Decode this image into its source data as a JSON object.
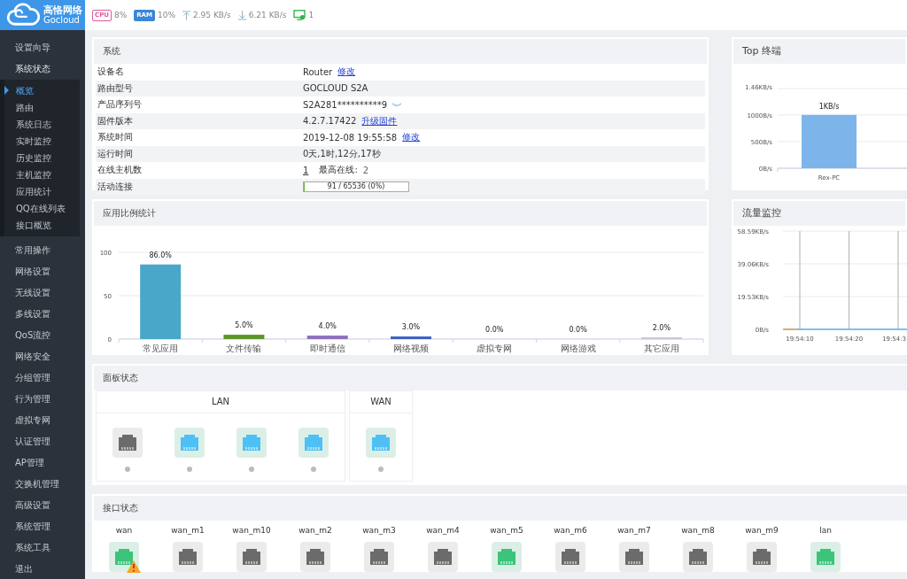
{
  "brand": {
    "name": "高恪网络",
    "sub": "Gocloud"
  },
  "status_bar": [
    {
      "kind": "cpu",
      "label": "CPU",
      "value": "8%"
    },
    {
      "kind": "ram",
      "label": "RAM",
      "value": "10%"
    },
    {
      "kind": "up",
      "value": "2.95 KB/s"
    },
    {
      "kind": "down",
      "value": "6.21 KB/s"
    },
    {
      "kind": "hosts",
      "value": "1"
    }
  ],
  "sidebar": {
    "items": [
      {
        "label": "设置向导"
      },
      {
        "label": "系统状态",
        "expanded": true,
        "children": [
          {
            "label": "概览",
            "selected": true
          },
          {
            "label": "路由",
            "selected": false
          },
          {
            "label": "系统日志",
            "selected": false
          },
          {
            "label": "实时监控",
            "selected": false
          },
          {
            "label": "历史监控",
            "selected": false
          },
          {
            "label": "主机监控",
            "selected": false
          },
          {
            "label": "应用统计",
            "selected": false
          },
          {
            "label": "QQ在线列表",
            "selected": false
          },
          {
            "label": "接口概览",
            "selected": false
          }
        ]
      },
      {
        "label": "常用操作"
      },
      {
        "label": "网络设置"
      },
      {
        "label": "无线设置"
      },
      {
        "label": "多线设置"
      },
      {
        "label": "QoS流控"
      },
      {
        "label": "网络安全"
      },
      {
        "label": "分组管理"
      },
      {
        "label": "行为管理"
      },
      {
        "label": "虚拟专网"
      },
      {
        "label": "认证管理"
      },
      {
        "label": "AP管理"
      },
      {
        "label": "交换机管理"
      },
      {
        "label": "高级设置"
      },
      {
        "label": "系统管理"
      },
      {
        "label": "系统工具"
      },
      {
        "label": "退出"
      }
    ]
  },
  "system": {
    "title": "系统",
    "rows": [
      {
        "kind": "text",
        "label": "设备名",
        "value": "Router",
        "link": "修改"
      },
      {
        "kind": "text",
        "label": "路由型号",
        "value": "GOCLOUD S2A"
      },
      {
        "kind": "serial",
        "label": "产品序列号",
        "value": "S2A281**********9"
      },
      {
        "kind": "text",
        "label": "固件版本",
        "value": "4.2.7.17422",
        "link": "升级固件"
      },
      {
        "kind": "text",
        "label": "系统时间",
        "value": "2019-12-08 19:55:58",
        "link": "修改"
      },
      {
        "kind": "text",
        "label": "运行时间",
        "value": "0天,1时,12分,17秒"
      },
      {
        "kind": "hosts",
        "label": "在线主机数",
        "value": "1",
        "extra_label": "最高在线:",
        "extra_value": "2"
      },
      {
        "kind": "progress",
        "label": "活动连接",
        "value": "91 / 65536 (0%)",
        "level": 0.0014
      }
    ]
  },
  "app_stats": {
    "title": "应用比例统计",
    "chart_data": {
      "type": "bar",
      "categories": [
        "常见应用",
        "文件传输",
        "即时通信",
        "网络视频",
        "虚拟专网",
        "网络游戏",
        "其它应用"
      ],
      "colors": [
        "#49a8c9",
        "#5e962a",
        "#8e6fbd",
        "#3b62c2",
        "#9aa0b8",
        "#9aa0b8",
        "#c4c8d8"
      ],
      "series": [
        {
          "values": [
            86,
            5,
            4,
            3,
            0,
            0,
            2
          ]
        }
      ],
      "ylim": [
        0,
        100
      ],
      "yticks": [
        0,
        50,
        100
      ],
      "value_labels": [
        "86.0%",
        "5.0%",
        "4.0%",
        "3.0%",
        "0.0%",
        "0.0%",
        "2.0%"
      ]
    }
  },
  "top_terminals": {
    "title": "Top 终端",
    "chart_data": {
      "type": "bar",
      "categories": [
        "Rex-PC"
      ],
      "series": [
        {
          "color": "#7db4ea",
          "values": [
            1000
          ]
        }
      ],
      "ylim": [
        0,
        1495
      ],
      "yticks": [
        {
          "value": 0,
          "label": "0B/s"
        },
        {
          "value": 500,
          "label": "500B/s"
        },
        {
          "value": 1000,
          "label": "1000B/s"
        }
      ],
      "value_labels": [
        "1KB/s"
      ]
    },
    "axis_top_label": "1.46KB/s"
  },
  "traffic": {
    "title": "流量监控",
    "y_labels": [
      "58.59KB/s",
      "39.06KB/s",
      "19.53KB/s",
      "0B/s"
    ],
    "x_labels": [
      "19:54:10",
      "19:54:20",
      "19:54:3"
    ]
  },
  "panel_status": {
    "title": "面板状态",
    "groups": [
      {
        "label": "LAN",
        "ports": [
          {
            "connected": false
          },
          {
            "connected": true
          },
          {
            "connected": true
          },
          {
            "connected": true
          }
        ]
      },
      {
        "label": "WAN",
        "ports": [
          {
            "connected": true
          }
        ]
      }
    ]
  },
  "interface_status": {
    "title": "接口状态",
    "interfaces": [
      {
        "name": "wan",
        "connected": true,
        "warning": true
      },
      {
        "name": "wan_m1",
        "connected": false,
        "warning": false
      },
      {
        "name": "wan_m10",
        "connected": false,
        "warning": false
      },
      {
        "name": "wan_m2",
        "connected": false,
        "warning": false
      },
      {
        "name": "wan_m3",
        "connected": false,
        "warning": false
      },
      {
        "name": "wan_m4",
        "connected": false,
        "warning": false
      },
      {
        "name": "wan_m5",
        "connected": true,
        "warning": false
      },
      {
        "name": "wan_m6",
        "connected": false,
        "warning": false
      },
      {
        "name": "wan_m7",
        "connected": false,
        "warning": false
      },
      {
        "name": "wan_m8",
        "connected": false,
        "warning": false
      },
      {
        "name": "wan_m9",
        "connected": false,
        "warning": false
      },
      {
        "name": "lan",
        "connected": true,
        "warning": false
      }
    ]
  }
}
